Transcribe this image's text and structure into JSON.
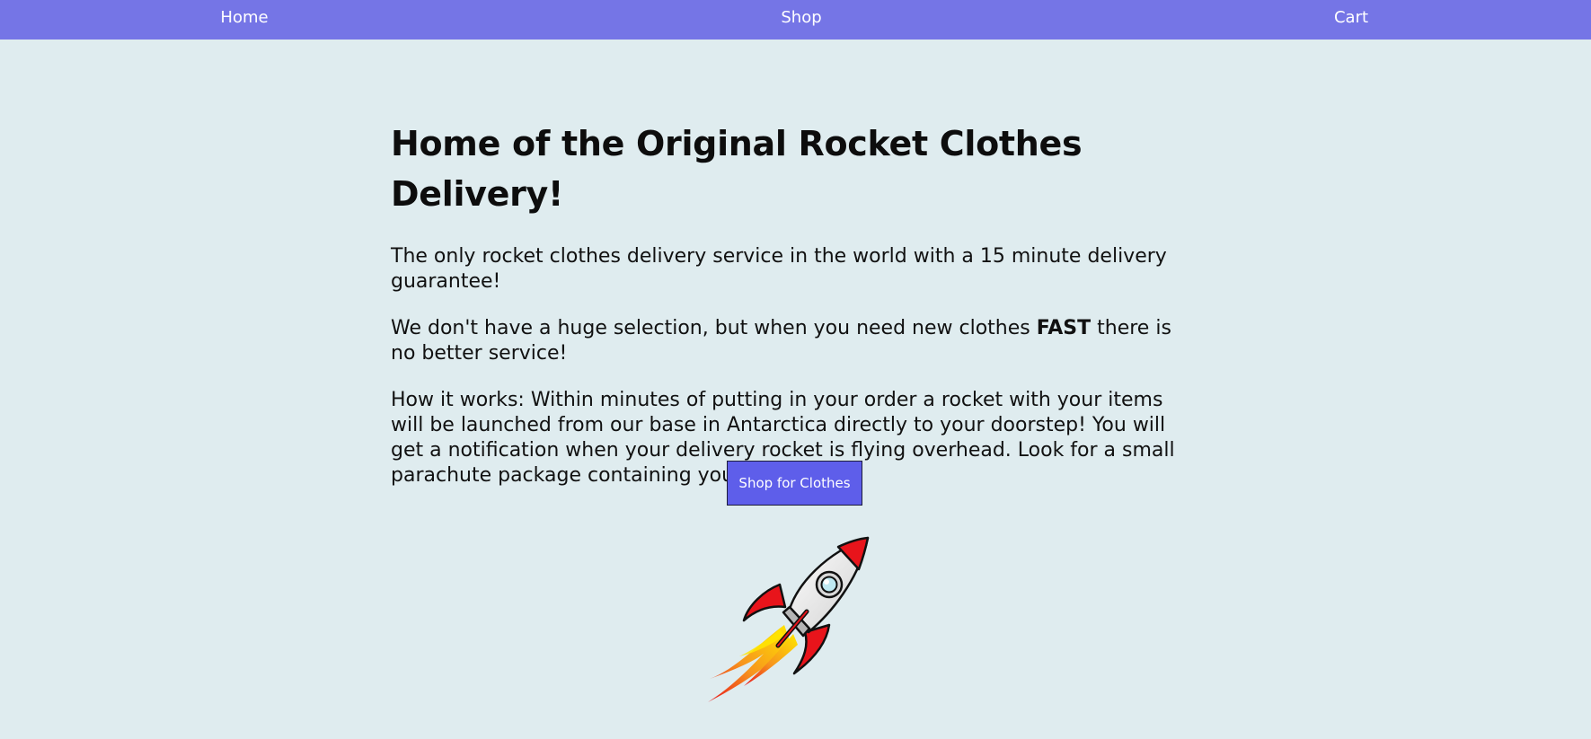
{
  "nav": {
    "home": "Home",
    "shop": "Shop",
    "cart": "Cart"
  },
  "main": {
    "title": "Home of the Original Rocket Clothes Delivery!",
    "para1": "The only rocket clothes delivery service in the world with a 15 minute delivery guarantee!",
    "para2_before": "We don't have a huge selection, but when you need new clothes ",
    "para2_bold": "FAST",
    "para2_after": " there is no better service!",
    "para3": "How it works: Within minutes of putting in your order a rocket with your items will be launched from our base in Antarctica directly to your doorstep! You will get a notification when your delivery rocket is flying overhead. Look for a small parachute package containing your order!",
    "cta_label": "Shop for Clothes"
  },
  "colors": {
    "navbar": "#7575e6",
    "background": "#dfecef",
    "button": "#5e5eea",
    "rocket_red": "#e8141b",
    "flame_orange": "#f7941d",
    "flame_yellow": "#ffe600"
  },
  "icons": {
    "rocket": "rocket-illustration"
  }
}
